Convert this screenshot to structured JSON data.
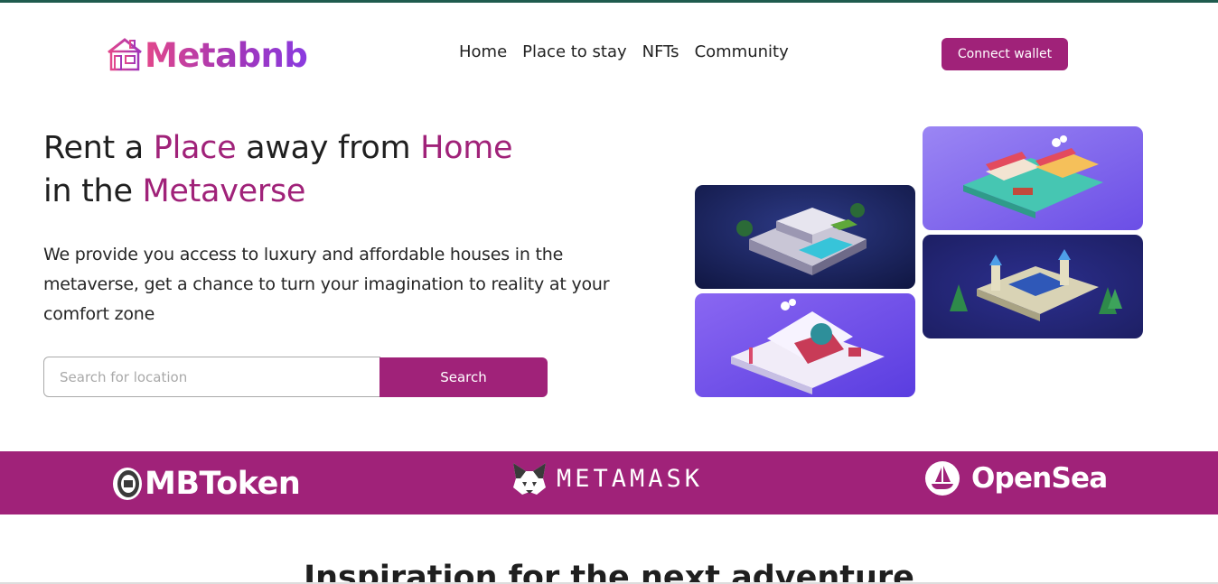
{
  "brand": {
    "name": "Metabnb",
    "icon": "house-icon"
  },
  "nav": {
    "items": [
      "Home",
      "Place to stay",
      "NFTs",
      "Community"
    ]
  },
  "header": {
    "connect_label": "Connect wallet"
  },
  "hero": {
    "headline": {
      "line1_a": "Rent a ",
      "line1_b": "Place",
      "line1_c": " away from ",
      "line1_d": "Home",
      "line2_a": "in the ",
      "line2_b": "Metaverse"
    },
    "description": "We provide you access to luxury and affordable houses in the metaverse, get a chance to turn your imagination to reality at your comfort zone",
    "search": {
      "placeholder": "Search for location",
      "button_label": "Search"
    }
  },
  "partners": [
    {
      "name": "MBToken",
      "icon": "mbtoken-coin-icon"
    },
    {
      "name": "METAMASK",
      "icon": "metamask-fox-icon"
    },
    {
      "name": "OpenSea",
      "icon": "opensea-boat-icon"
    }
  ],
  "section": {
    "title": "Inspiration for the next adventure"
  },
  "colors": {
    "accent": "#a02279",
    "brand_gradient_start": "#e2478b",
    "brand_gradient_end": "#8a3be0"
  }
}
